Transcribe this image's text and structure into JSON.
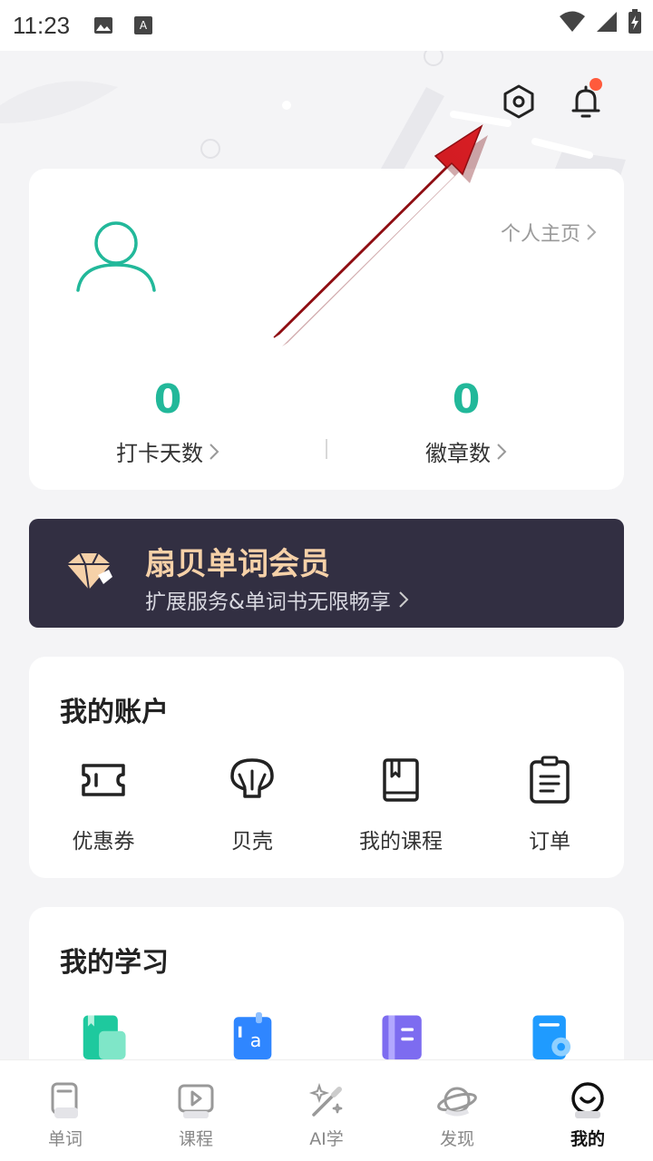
{
  "status_bar": {
    "time": "11:23"
  },
  "profile": {
    "profile_link": "个人主页",
    "checkin_days_value": "0",
    "checkin_days_label": "打卡天数",
    "badges_value": "0",
    "badges_label": "徽章数"
  },
  "vip": {
    "title": "扇贝单词会员",
    "subtitle": "扩展服务&单词书无限畅享"
  },
  "account": {
    "title": "我的账户",
    "items": [
      {
        "label": "优惠券",
        "icon": "ticket-icon"
      },
      {
        "label": "贝壳",
        "icon": "shell-icon"
      },
      {
        "label": "我的课程",
        "icon": "book-icon"
      },
      {
        "label": "订单",
        "icon": "clipboard-icon"
      }
    ]
  },
  "study": {
    "title": "我的学习"
  },
  "tabs": [
    {
      "label": "单词",
      "icon": "word-card-icon"
    },
    {
      "label": "课程",
      "icon": "play-icon"
    },
    {
      "label": "AI学",
      "icon": "magic-wand-icon"
    },
    {
      "label": "发现",
      "icon": "planet-icon"
    },
    {
      "label": "我的",
      "icon": "smile-icon",
      "active": true
    }
  ],
  "colors": {
    "accent": "#22b89a",
    "vip_bg": "#322f42",
    "vip_title": "#f6d1a8",
    "notif_dot": "#ff5a3c",
    "arrow": "#c8161d"
  }
}
